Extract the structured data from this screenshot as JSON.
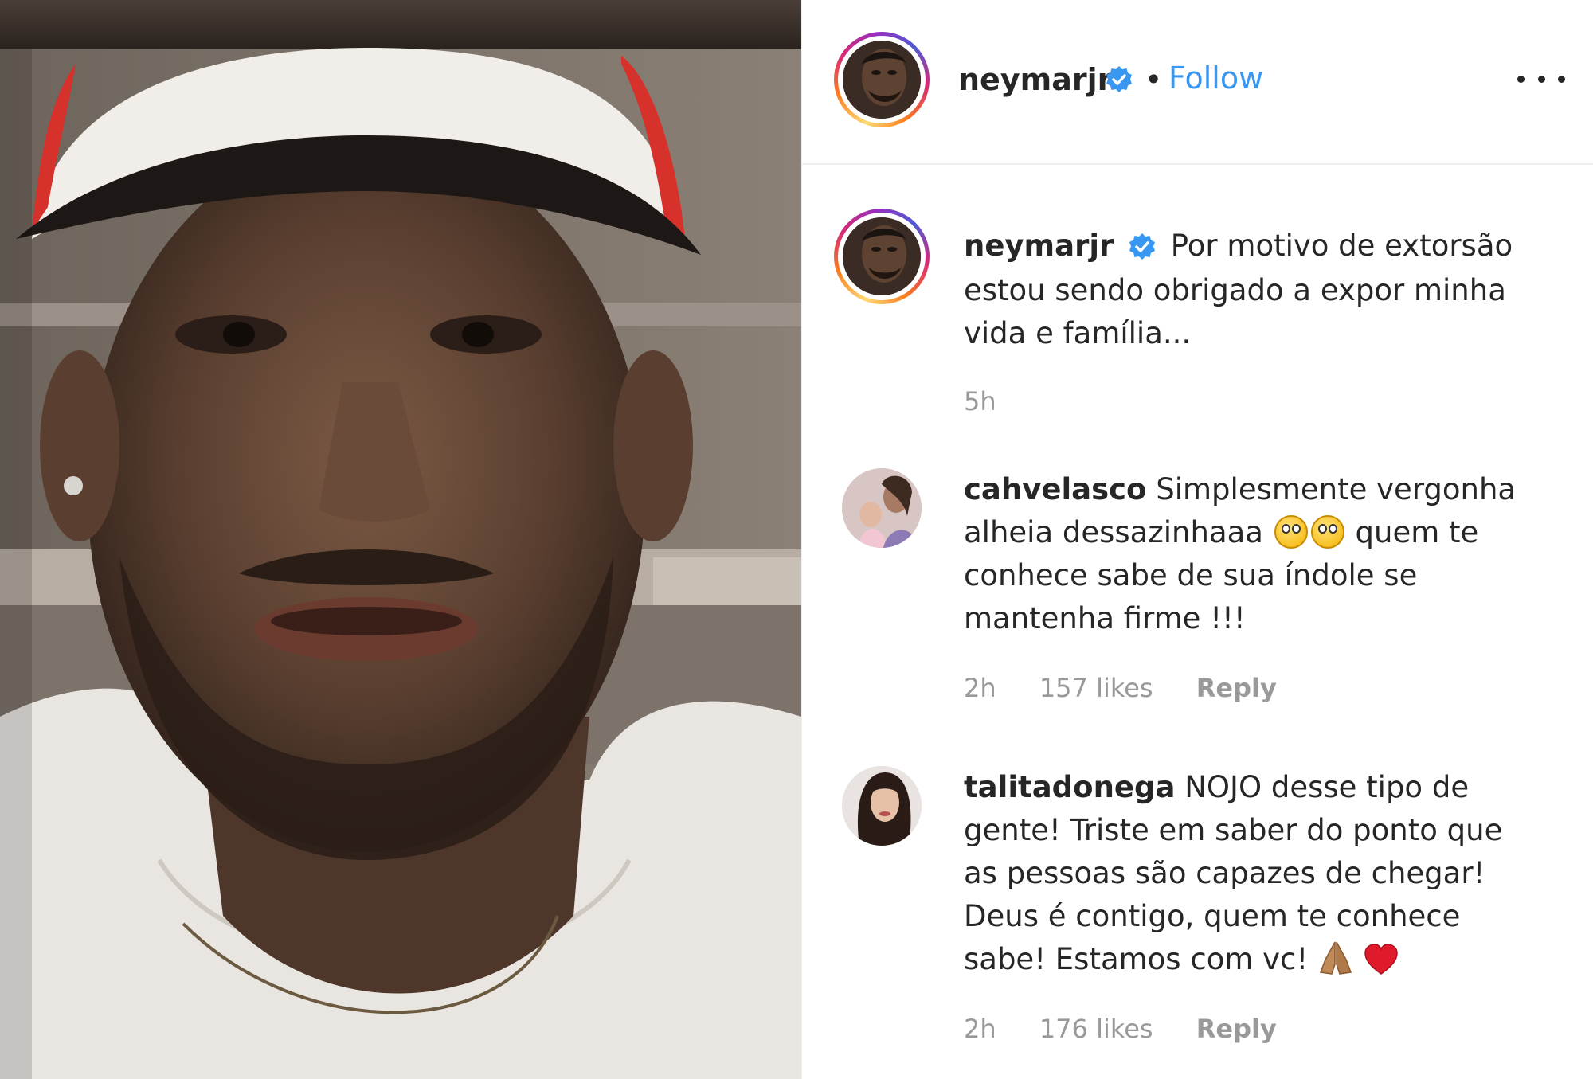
{
  "post": {
    "author": "neymarjr",
    "follow_label": "Follow",
    "separator": "•"
  },
  "caption": {
    "username": "neymarjr",
    "text": "Por motivo de extorsão estou sendo obrigado a expor minha vida e família...",
    "time": "5h"
  },
  "comments": [
    {
      "username": "cahvelasco",
      "text_before": "Simplesmente vergonha alheia dessazinhaaa",
      "emojis": [
        "eye-roll-emoji",
        "eye-roll-emoji"
      ],
      "text_after": "quem te conhece sabe de sua índole se mantenha firme !!!",
      "time": "2h",
      "likes": "157 likes",
      "reply_label": "Reply"
    },
    {
      "username": "talitadonega",
      "text_before": "NOJO desse tipo de gente! Triste em saber do ponto que as pessoas são capazes de chegar! Deus é contigo, quem te conhece sabe! Estamos com vc!",
      "emojis": [
        "folded-hands-emoji",
        "red-heart-emoji"
      ],
      "time": "2h",
      "likes": "176 likes",
      "reply_label": "Reply"
    }
  ],
  "colors": {
    "link_blue": "#3897f0",
    "verified_blue": "#3897f0",
    "meta_gray": "#999999",
    "text": "#262626"
  }
}
